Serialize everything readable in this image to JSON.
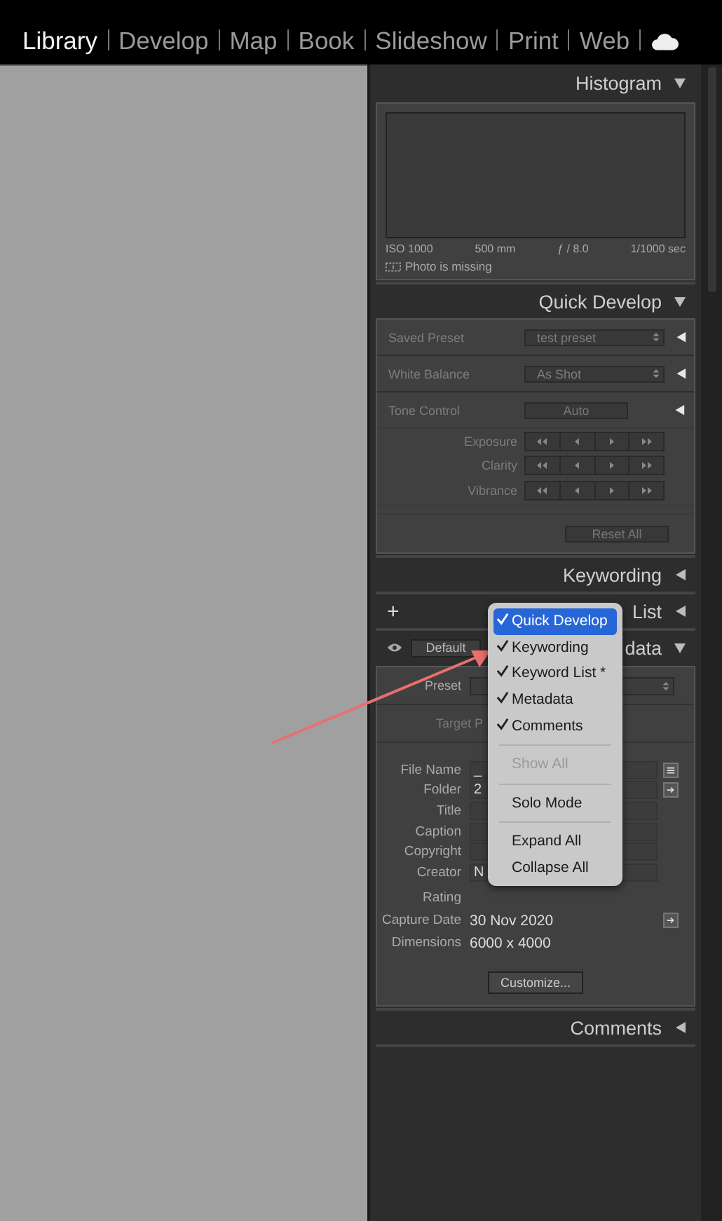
{
  "modules": [
    {
      "label": "Library",
      "selected": true
    },
    {
      "label": "Develop",
      "selected": false
    },
    {
      "label": "Map",
      "selected": false
    },
    {
      "label": "Book",
      "selected": false
    },
    {
      "label": "Slideshow",
      "selected": false
    },
    {
      "label": "Print",
      "selected": false
    },
    {
      "label": "Web",
      "selected": false
    }
  ],
  "histogram": {
    "title": "Histogram",
    "expanded": true,
    "stats": [
      "ISO 1000",
      "500 mm",
      "ƒ / 8.0",
      "1/1000 sec"
    ],
    "status": "Photo is missing"
  },
  "quick_develop": {
    "title": "Quick Develop",
    "expanded": true,
    "rows": [
      {
        "kind": "select",
        "label": "Saved Preset",
        "value": "test preset"
      },
      {
        "kind": "select",
        "label": "White Balance",
        "value": "As Shot"
      },
      {
        "kind": "button",
        "label": "Tone Control",
        "value": "Auto"
      },
      {
        "kind": "stepper",
        "label": "Exposure"
      },
      {
        "kind": "stepper",
        "label": "Clarity"
      },
      {
        "kind": "stepper",
        "label": "Vibrance"
      },
      {
        "kind": "reset",
        "value": "Reset All"
      }
    ]
  },
  "keywording": {
    "title": "Keywording",
    "expanded": false
  },
  "keyword_list": {
    "title": "List",
    "expanded": false,
    "add": "+"
  },
  "metadata": {
    "title": "data",
    "expanded": true,
    "preset_button": "Default",
    "preset_label": "Preset",
    "target": "Target P",
    "fields": [
      {
        "kind": "field",
        "label": "File Name",
        "value": "_",
        "list_button": true
      },
      {
        "kind": "field",
        "label": "Folder",
        "value": "2",
        "goto_button": true
      },
      {
        "kind": "field",
        "label": "Title"
      },
      {
        "kind": "field",
        "label": "Caption"
      },
      {
        "kind": "field",
        "label": "Copyright"
      },
      {
        "kind": "field",
        "label": "Creator",
        "value": "N"
      },
      {
        "kind": "text",
        "label": "Rating"
      },
      {
        "kind": "text",
        "label": "Capture Date",
        "value": "30 Nov 2020",
        "goto_button": true
      },
      {
        "kind": "text",
        "label": "Dimensions",
        "value": "6000 x 4000"
      }
    ],
    "button": "Customize..."
  },
  "comments": {
    "title": "Comments",
    "expanded": false
  },
  "context_menu": [
    {
      "kind": "item",
      "label": "Quick Develop",
      "checked": true,
      "selected": true,
      "disabled": false
    },
    {
      "kind": "item",
      "label": "Keywording",
      "checked": true,
      "selected": false,
      "disabled": false
    },
    {
      "kind": "item",
      "label": "Keyword List *",
      "checked": true,
      "selected": false,
      "disabled": false
    },
    {
      "kind": "item",
      "label": "Metadata",
      "checked": true,
      "selected": false,
      "disabled": false
    },
    {
      "kind": "item",
      "label": "Comments",
      "checked": true,
      "selected": false,
      "disabled": false
    },
    {
      "kind": "separator"
    },
    {
      "kind": "item",
      "label": "Show All",
      "checked": false,
      "selected": false,
      "disabled": true
    },
    {
      "kind": "separator"
    },
    {
      "kind": "item",
      "label": "Solo Mode",
      "checked": false,
      "selected": false,
      "disabled": false
    },
    {
      "kind": "separator"
    },
    {
      "kind": "item",
      "label": "Expand All",
      "checked": false,
      "selected": false,
      "disabled": false
    },
    {
      "kind": "item",
      "label": "Collapse All",
      "checked": false,
      "selected": false,
      "disabled": false
    }
  ]
}
